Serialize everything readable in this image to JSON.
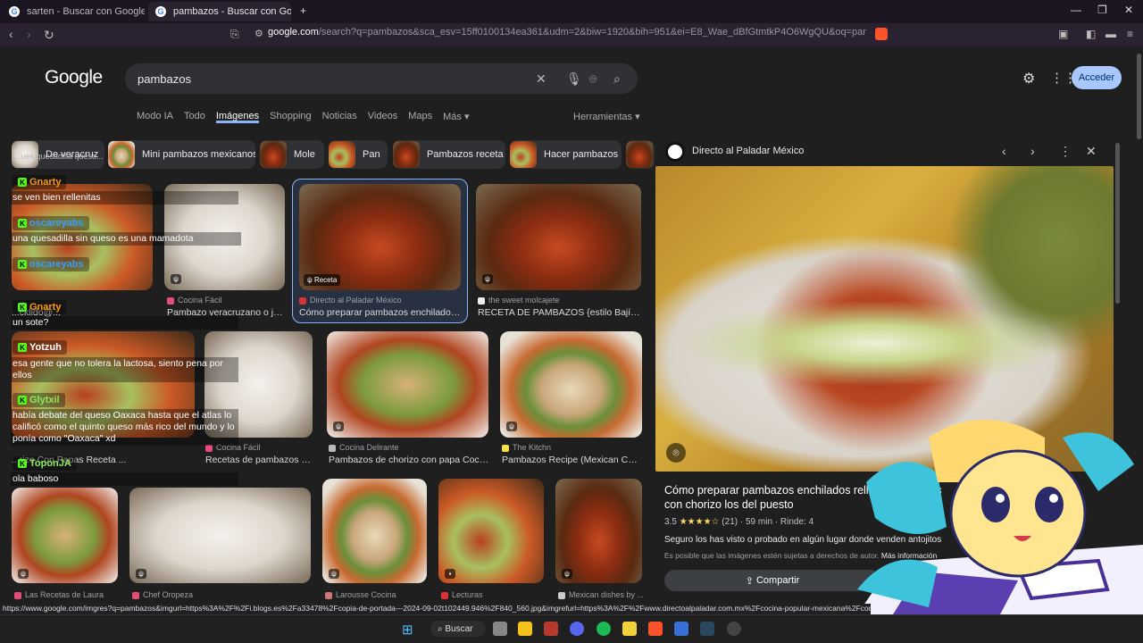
{
  "browser": {
    "tabs": [
      {
        "title": "sarten - Buscar con Google"
      },
      {
        "title": "pambazos - Buscar con Google"
      }
    ],
    "new_tab": "+",
    "url_host": "google.com",
    "url_rest": "/search?q=pambazos&sca_esv=15ff0100134ea361&udm=2&biw=1920&bih=951&ei=E8_Wae_dBfGtmtkP4O6WgQU&oq=pambas&gs_lp=Egtnd3...",
    "status_url": "https://www.google.com/imgres?q=pambazos&imgurl=https%3A%2F%2Fi.blogs.es%2Fa33478%2Fcopia-de-portada---2024-09-02t102449.946%2F840_560.jpg&imgrefurl=https%3A%2F%2Fwww.directoalpaladar.com.mx%2Fcocina-popular-mexicana%2Fcomo-preparar-pamb"
  },
  "google": {
    "logo": "Google",
    "query": "pambazos",
    "signin": "Acceder",
    "nav_tabs": [
      "Modo IA",
      "Todo",
      "Imágenes",
      "Shopping",
      "Noticias",
      "Videos",
      "Maps",
      "Más ▾"
    ],
    "tools": "Herramientas ▾",
    "chips": [
      "De veracruz",
      "Mini pambazos mexicanos",
      "Mole",
      "Pan",
      "Pambazos receta",
      "Hacer pambazos"
    ]
  },
  "results": {
    "row1": [
      {
        "source": "Cocina Fácil",
        "caption": "Pambazo veracruzano o jal..."
      },
      {
        "source": "Directo al Paladar México",
        "caption": "Cómo preparar pambazos enchilados re...",
        "tag": "Receta"
      },
      {
        "source": "the sweet molcajete",
        "caption": "RECETA DE PAMBAZOS {estilo Bajío} -..."
      }
    ],
    "row1_left_caption": "...cklido@...",
    "row2": [
      {
        "source": "Cocina Fácil",
        "caption": "Recetas de pambazos qu..."
      },
      {
        "source": "Cocina Delirante",
        "caption": "Pambazos de chorizo con papa Cocin..."
      },
      {
        "source": "The Kitchn",
        "caption": "Pambazos Recipe (Mexican Chor..."
      }
    ],
    "row2_left_caption": "...rizo Con Papas Receta ...",
    "row3": [
      {
        "source": "Las Recetas de Laura"
      },
      {
        "source": "Chef Oropeza"
      },
      {
        "source": "Larousse Cocina"
      },
      {
        "source": "Lecturas"
      },
      {
        "source": "Mexican dishes by ..."
      }
    ]
  },
  "chat": [
    {
      "name": "Gnarty",
      "msg": "se ven bien rellenitas",
      "color": "#ff9a00"
    },
    {
      "name": "oscareyabs",
      "msg": "una quesadilla sin queso es una mamadota",
      "color": "#3a9cff"
    },
    {
      "name": "oscareyabs",
      "msg": "",
      "color": "#3a9cff"
    },
    {
      "name": "Gnarty",
      "msg": "un sote?",
      "color": "#ff9a00"
    },
    {
      "name": "Yotzuh",
      "msg": "esa gente que no tolera la lactosa, siento pena por ellos",
      "color": "#ffffff"
    },
    {
      "name": "Glytxil",
      "msg": "había debate del queso Oaxaca hasta que el atlas lo calificó como el quinto queso más rico del mundo y lo ponía como \"Oaxaca\" xd",
      "color": "#8fe85a"
    },
    {
      "name": "ToponJA",
      "msg": "ola baboso",
      "color": "#8fe85a"
    }
  ],
  "chat_top_residue": "...ues quesadilla queso...",
  "panel": {
    "source": "Directo al Paladar México",
    "title": "Cómo preparar pambazos enchilados rellenos de papas con chorizo los del puesto",
    "rating": "3.5",
    "stars": "★★★★☆",
    "reviews": "(21)",
    "time": "59 min",
    "yield": "Rinde: 4",
    "description": "Seguro los has visto o probado en algún lugar donde venden antojitos",
    "note": "Es posible que las imágenes estén sujetas a derechos de autor.",
    "note_link": "Más información",
    "share": "Compartir"
  },
  "taskbar": {
    "search": "Buscar"
  }
}
